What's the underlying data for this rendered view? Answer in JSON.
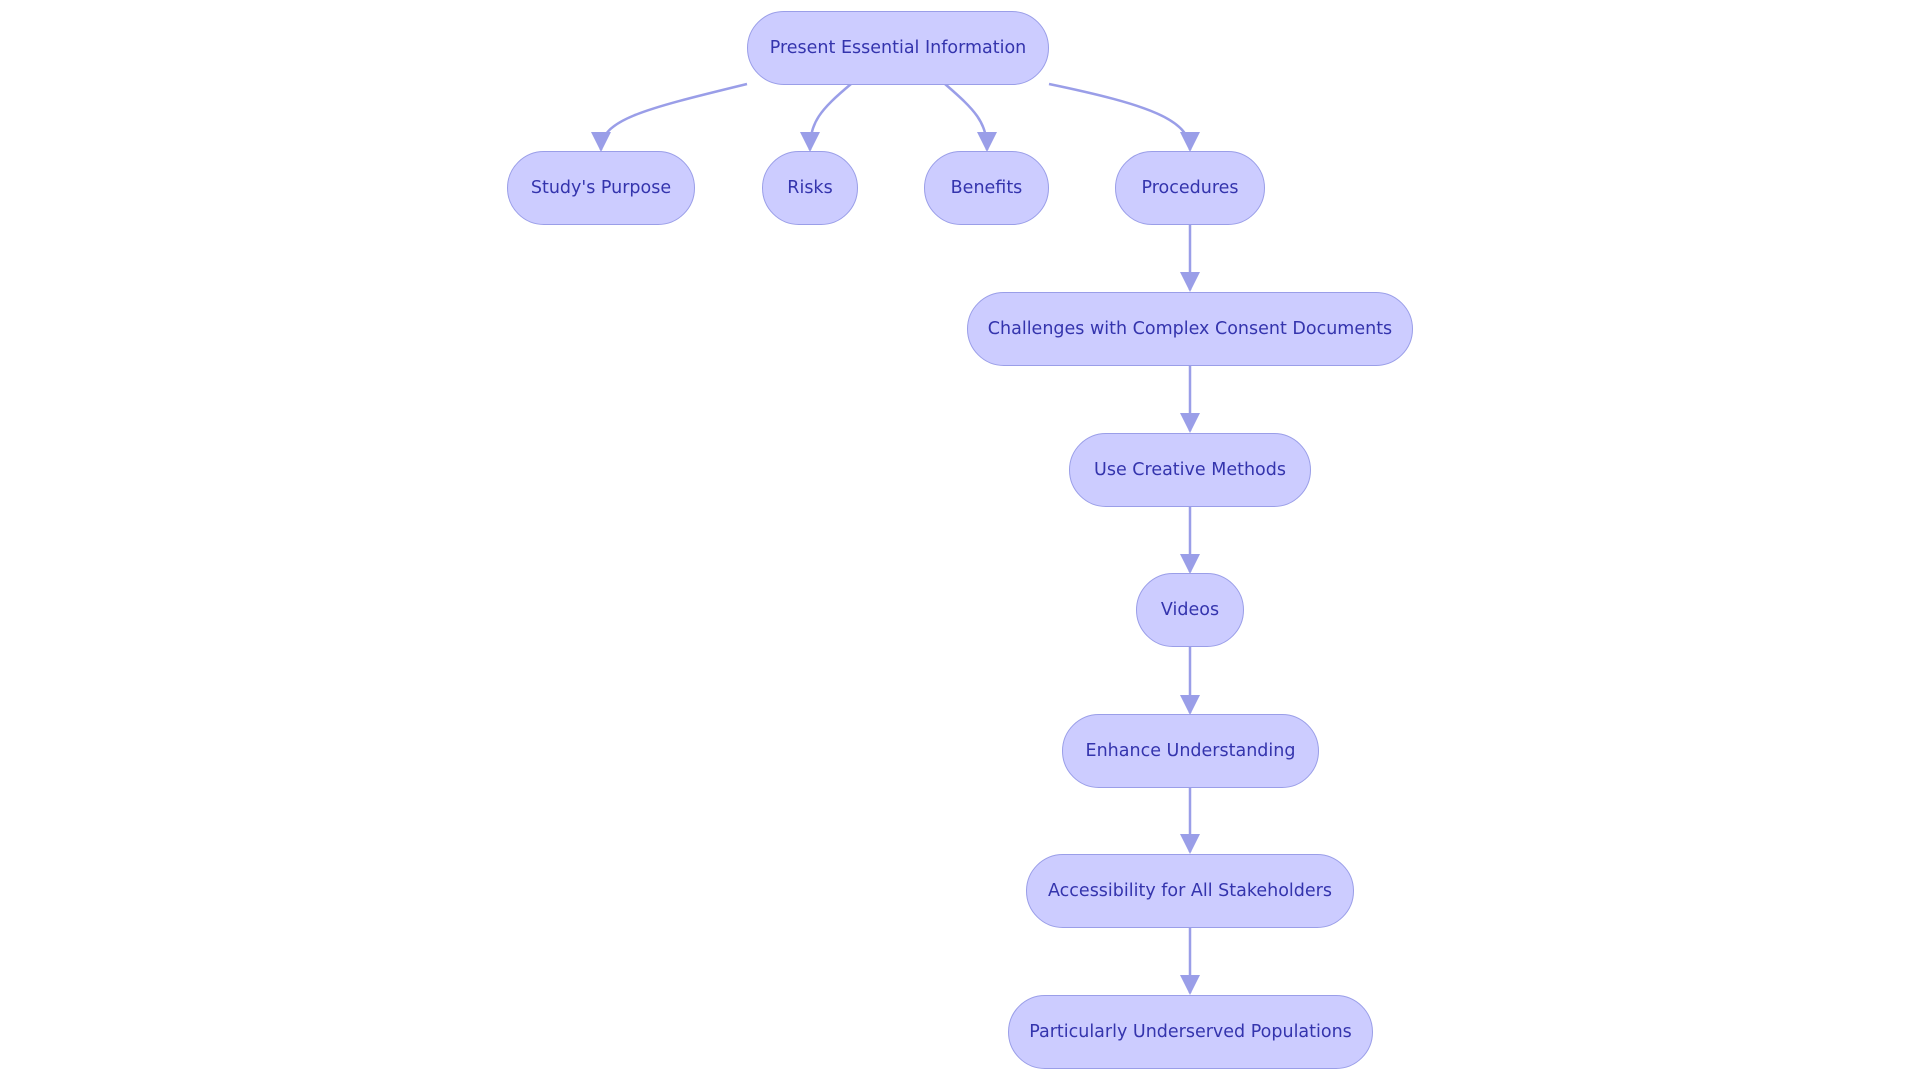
{
  "diagram": {
    "type": "flowchart",
    "colors": {
      "node_fill": "#ccccff",
      "node_border": "#9a9ee8",
      "edge": "#9a9ee8",
      "text": "#3434ad"
    },
    "nodes": {
      "root": "Present Essential Information",
      "purpose": "Study's Purpose",
      "risks": "Risks",
      "benefits": "Benefits",
      "procedures": "Procedures",
      "challenges": "Challenges with Complex Consent Documents",
      "creative": "Use Creative Methods",
      "videos": "Videos",
      "enhance": "Enhance Understanding",
      "accessibility": "Accessibility for All Stakeholders",
      "underserved": "Particularly Underserved Populations"
    },
    "edges": [
      [
        "root",
        "purpose"
      ],
      [
        "root",
        "risks"
      ],
      [
        "root",
        "benefits"
      ],
      [
        "root",
        "procedures"
      ],
      [
        "procedures",
        "challenges"
      ],
      [
        "challenges",
        "creative"
      ],
      [
        "creative",
        "videos"
      ],
      [
        "videos",
        "enhance"
      ],
      [
        "enhance",
        "accessibility"
      ],
      [
        "accessibility",
        "underserved"
      ]
    ]
  }
}
